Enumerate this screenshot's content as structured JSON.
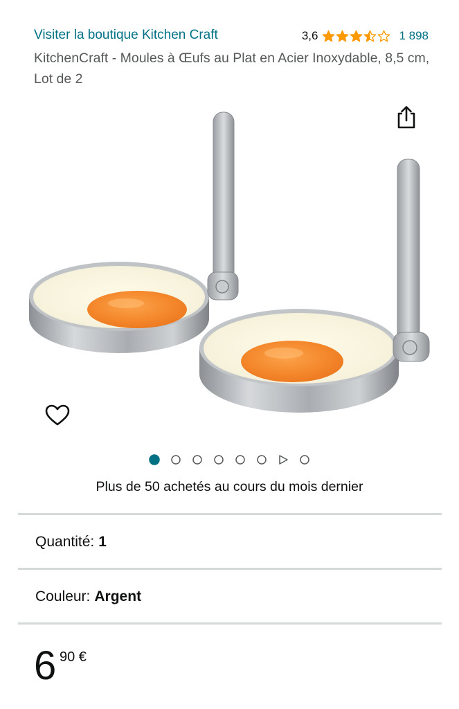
{
  "store": {
    "link_label": "Visiter la boutique Kitchen Craft"
  },
  "rating": {
    "value": "3,6",
    "stars": 3.5,
    "count": "1 898",
    "star_color": "#ff9900"
  },
  "product": {
    "title": "KitchenCraft - Moules à Œufs au Plat en Acier Inoxydable, 8,5 cm, Lot de 2",
    "image_icon": "product-photo-egg-rings"
  },
  "actions": {
    "share_icon": "share-icon",
    "wishlist_icon": "heart-icon"
  },
  "carousel": {
    "total": 8,
    "active_index": 0,
    "video_index": 6,
    "active_color": "#007185"
  },
  "social_proof": {
    "text": "Plus de 50 achetés au cours du mois dernier"
  },
  "quantity": {
    "label": "Quantité:",
    "value": "1"
  },
  "color": {
    "label": "Couleur:",
    "value": "Argent"
  },
  "price": {
    "whole": "6",
    "fraction": "90 €"
  },
  "colors": {
    "link": "#007185",
    "text": "#0f1111",
    "secondary_text": "#565959",
    "divider": "#d5d9d9"
  }
}
